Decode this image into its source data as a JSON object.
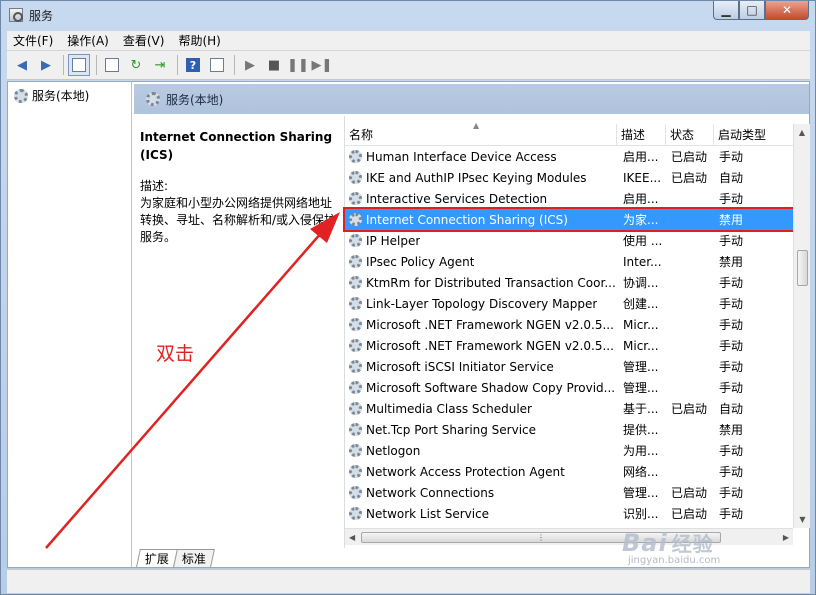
{
  "window": {
    "title": "服务",
    "minimize": "▁",
    "maximize": "□",
    "close": "✕"
  },
  "menu": [
    "文件(F)",
    "操作(A)",
    "查看(V)",
    "帮助(H)"
  ],
  "tree": {
    "root_label": "服务(本地)"
  },
  "main": {
    "header": "服务(本地)",
    "desc_title": "Internet Connection Sharing (ICS)",
    "desc_label": "描述:",
    "desc_text": "为家庭和小型办公网络提供网络地址转换、寻址、名称解析和/或入侵保护服务。"
  },
  "columns": [
    "名称",
    "描述",
    "状态",
    "启动类型"
  ],
  "rows": [
    {
      "name": "Human Interface Device Access",
      "desc": "启用...",
      "status": "已启动",
      "startup": "手动"
    },
    {
      "name": "IKE and AuthIP IPsec Keying Modules",
      "desc": "IKEE...",
      "status": "已启动",
      "startup": "自动"
    },
    {
      "name": "Interactive Services Detection",
      "desc": "启用...",
      "status": "",
      "startup": "手动"
    },
    {
      "name": "Internet Connection Sharing (ICS)",
      "desc": "为家...",
      "status": "",
      "startup": "禁用"
    },
    {
      "name": "IP Helper",
      "desc": "使用 ...",
      "status": "",
      "startup": "手动"
    },
    {
      "name": "IPsec Policy Agent",
      "desc": "Inter...",
      "status": "",
      "startup": "禁用"
    },
    {
      "name": "KtmRm for Distributed Transaction Coor...",
      "desc": "协调...",
      "status": "",
      "startup": "手动"
    },
    {
      "name": "Link-Layer Topology Discovery Mapper",
      "desc": "创建...",
      "status": "",
      "startup": "手动"
    },
    {
      "name": "Microsoft .NET Framework NGEN v2.0.5...",
      "desc": "Micr...",
      "status": "",
      "startup": "手动"
    },
    {
      "name": "Microsoft .NET Framework NGEN v2.0.5...",
      "desc": "Micr...",
      "status": "",
      "startup": "手动"
    },
    {
      "name": "Microsoft iSCSI Initiator Service",
      "desc": "管理...",
      "status": "",
      "startup": "手动"
    },
    {
      "name": "Microsoft Software Shadow Copy Provid...",
      "desc": "管理...",
      "status": "",
      "startup": "手动"
    },
    {
      "name": "Multimedia Class Scheduler",
      "desc": "基于...",
      "status": "已启动",
      "startup": "自动"
    },
    {
      "name": "Net.Tcp Port Sharing Service",
      "desc": "提供...",
      "status": "",
      "startup": "禁用"
    },
    {
      "name": "Netlogon",
      "desc": "为用...",
      "status": "",
      "startup": "手动"
    },
    {
      "name": "Network Access Protection Agent",
      "desc": "网络...",
      "status": "",
      "startup": "手动"
    },
    {
      "name": "Network Connections",
      "desc": "管理...",
      "status": "已启动",
      "startup": "手动"
    },
    {
      "name": "Network List Service",
      "desc": "识别...",
      "status": "已启动",
      "startup": "手动"
    }
  ],
  "selected_row": 3,
  "tabs": [
    "扩展",
    "标准"
  ],
  "annotation": {
    "text": "双击",
    "color": "#e02222"
  },
  "watermark": {
    "logo": "Bai",
    "logo_cn": "经验",
    "url": "jingyan.baidu.com"
  }
}
